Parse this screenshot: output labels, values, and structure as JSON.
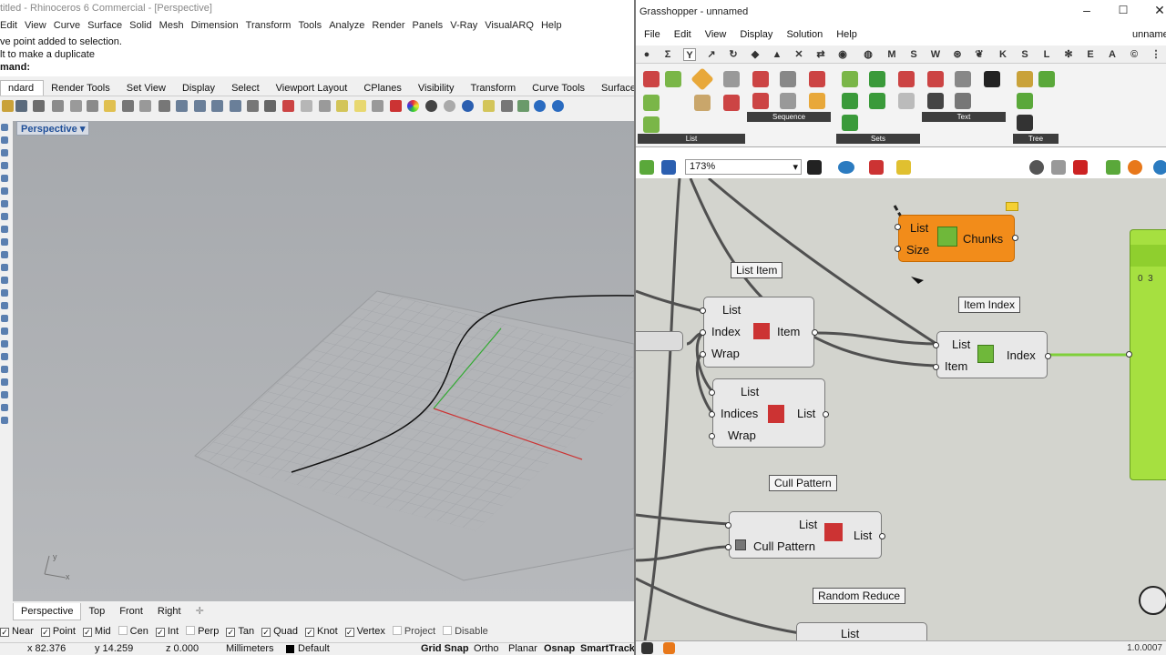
{
  "rhino": {
    "title": "titled - Rhinoceros 6 Commercial - [Perspective]",
    "menu": [
      "Edit",
      "View",
      "Curve",
      "Surface",
      "Solid",
      "Mesh",
      "Dimension",
      "Transform",
      "Tools",
      "Analyze",
      "Render",
      "Panels",
      "V-Ray",
      "VisualARQ",
      "Help"
    ],
    "command_history": [
      "ve point added to selection.",
      "lt to make a duplicate"
    ],
    "command_prompt": "mand:",
    "toolbar_tabs": [
      "ndard",
      "Render Tools",
      "Set View",
      "Display",
      "Select",
      "Viewport Layout",
      "CPlanes",
      "Visibility",
      "Transform",
      "Curve Tools",
      "Surface To"
    ],
    "viewport": {
      "label": "Perspective",
      "axis_x": "x",
      "axis_y": "y"
    },
    "viewport_tabs": [
      "Perspective",
      "Top",
      "Front",
      "Right"
    ],
    "osnaps": [
      {
        "label": "Near",
        "checked": true
      },
      {
        "label": "Point",
        "checked": true
      },
      {
        "label": "Mid",
        "checked": true
      },
      {
        "label": "Cen",
        "checked": false
      },
      {
        "label": "Int",
        "checked": true
      },
      {
        "label": "Perp",
        "checked": false
      },
      {
        "label": "Tan",
        "checked": true
      },
      {
        "label": "Quad",
        "checked": true
      },
      {
        "label": "Knot",
        "checked": true
      },
      {
        "label": "Vertex",
        "checked": true
      },
      {
        "label": "Project",
        "checked": false
      },
      {
        "label": "Disable",
        "checked": false
      }
    ],
    "status": {
      "x": "x 82.376",
      "y": "y 14.259",
      "z": "z 0.000",
      "units": "Millimeters",
      "layer": "Default",
      "grid_snap": "Grid Snap",
      "ortho": "Ortho",
      "planar": "Planar",
      "osnap": "Osnap",
      "smarttrack": "SmartTrack"
    }
  },
  "gh": {
    "title": "Grasshopper - unnamed",
    "title_right": "unname",
    "menu": [
      "File",
      "Edit",
      "View",
      "Display",
      "Solution",
      "Help"
    ],
    "category_tabs": [
      "M",
      "S",
      "W",
      "K",
      "S",
      "L",
      "E",
      "A"
    ],
    "panels": {
      "list": "List",
      "sequence": "Sequence",
      "sets": "Sets",
      "text": "Text",
      "tree": "Tree"
    },
    "zoom": "173%",
    "components": {
      "chunks": {
        "in1": "List",
        "in2": "Size",
        "name": "Chunks"
      },
      "list_item": {
        "tag": "List Item",
        "in1": "List",
        "in2": "Index",
        "in3": "Wrap",
        "out": "Item"
      },
      "item_index": {
        "tag": "Item Index",
        "in1": "List",
        "in2": "Item",
        "out": "Index"
      },
      "cull_index": {
        "in1": "List",
        "in2": "Indices",
        "in3": "Wrap",
        "out": "List"
      },
      "cull_pattern": {
        "tag": "Cull Pattern",
        "in1": "List",
        "in2": "Cull Pattern",
        "out": "List"
      },
      "random_reduce": {
        "tag": "Random Reduce",
        "in1": "List"
      },
      "panel_value": "0  3"
    },
    "version": "1.0.0007",
    "status_left": "..."
  }
}
